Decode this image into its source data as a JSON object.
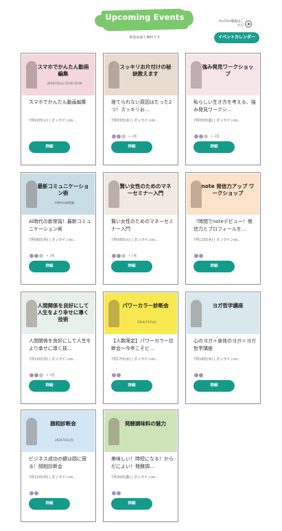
{
  "header": {
    "title": "Upcoming Events",
    "subtitle": "参加出来て無料です",
    "youtube_link": "YouTube動画はこちら",
    "calendar_button": "イベントカレンダー"
  },
  "detail_label": "詳細",
  "events": [
    {
      "thumb_text": "スマホでかんたん動画編集",
      "thumb_sub": "2024/7/2(火) 13:00-15:00",
      "title": "スマホでかんたん動画編集",
      "meta": "7月02日(火) | オンラインzo...",
      "attendees": "",
      "thumb_bg": "#f3d7dc",
      "avatars": 0
    },
    {
      "thumb_text": "スッキリお片付けの秘訣教えます",
      "thumb_sub": "",
      "title": "捨てられない原因はたった2つ！スッキリお...",
      "meta": "7月03日(水) | オンラインzo...",
      "attendees": "+ 2名",
      "thumb_bg": "#e8dccf",
      "avatars": 3
    },
    {
      "thumb_text": "強み発見ワークショップ",
      "thumb_sub": "",
      "title": "私らしい生き方を考える、強み発見ワークシ...",
      "meta": "7月05日(金) | オンラインzo...",
      "attendees": "+ 2名",
      "thumb_bg": "#f6e6ea",
      "avatars": 3
    },
    {
      "thumb_text": "最新コミュニケーション術",
      "thumb_sub": "AI時代の新常識",
      "title": "AI時代の新常識！最新コミュニケーション術",
      "meta": "7月08日(月) | オンラインzo...",
      "attendees": "+ 2名",
      "thumb_bg": "#c9dde6",
      "avatars": 3
    },
    {
      "thumb_text": "賢い女性のためのマネーセミナー入門",
      "thumb_sub": "",
      "title": "賢い女性のためのマネーセミナー入門",
      "meta": "7月09日(火) | オンラインzo...",
      "attendees": "+ 1名",
      "thumb_bg": "#f2e9e3",
      "avatars": 3
    },
    {
      "thumb_text": "note 発信力アップ ワークショップ",
      "thumb_sub": "",
      "title": "『時間でnoteデビュー！発信力とプロフィールを...",
      "meta": "7月11日(木) | オンラインzo...",
      "attendees": "",
      "thumb_bg": "#fbe2c8",
      "avatars": 2
    },
    {
      "thumb_text": "人間関係を良好にして人生をより幸せに導く技術",
      "thumb_sub": "",
      "title": "人間関係を良好にして人生をより幸せに導く技...",
      "meta": "7月15日(月) | オンラインzo...",
      "attendees": "+ 2名",
      "thumb_bg": "#e7f0ea",
      "avatars": 3
    },
    {
      "thumb_text": "パワーカラー診断会",
      "thumb_sub": "2024/7/17(水)",
      "title": "【人数限定】パワーカラー診断会〜今年こそビ...",
      "meta": "7月17日(水) | オンラインzo...",
      "attendees": "",
      "thumb_bg": "#f7e94f",
      "avatars": 2
    },
    {
      "thumb_text": "ヨガ哲学講座",
      "thumb_sub": "",
      "title": "心のヨガ＋身体のヨガ＝ヨガ哲学講座",
      "meta": "7月18日(木) | オンラインzo...",
      "attendees": "",
      "thumb_bg": "#d9e9ee",
      "avatars": 2
    },
    {
      "thumb_text": "顔相診断会",
      "thumb_sub": "2024/7/22(月)",
      "title": "ビジネス成功の鍵は顔に宿る！顔相診断会",
      "meta": "7月22日(月) | オンラインzo...",
      "attendees": "",
      "thumb_bg": "#d3e6f5",
      "avatars": 2
    },
    {
      "thumb_text": "発酵調味料の魅力",
      "thumb_sub": "",
      "title": "美味しい！時短になる！からだによい！発酵調...",
      "meta": "7月26日(金) | オンラインzo...",
      "attendees": "",
      "thumb_bg": "#cfe3b8",
      "avatars": 2
    }
  ]
}
